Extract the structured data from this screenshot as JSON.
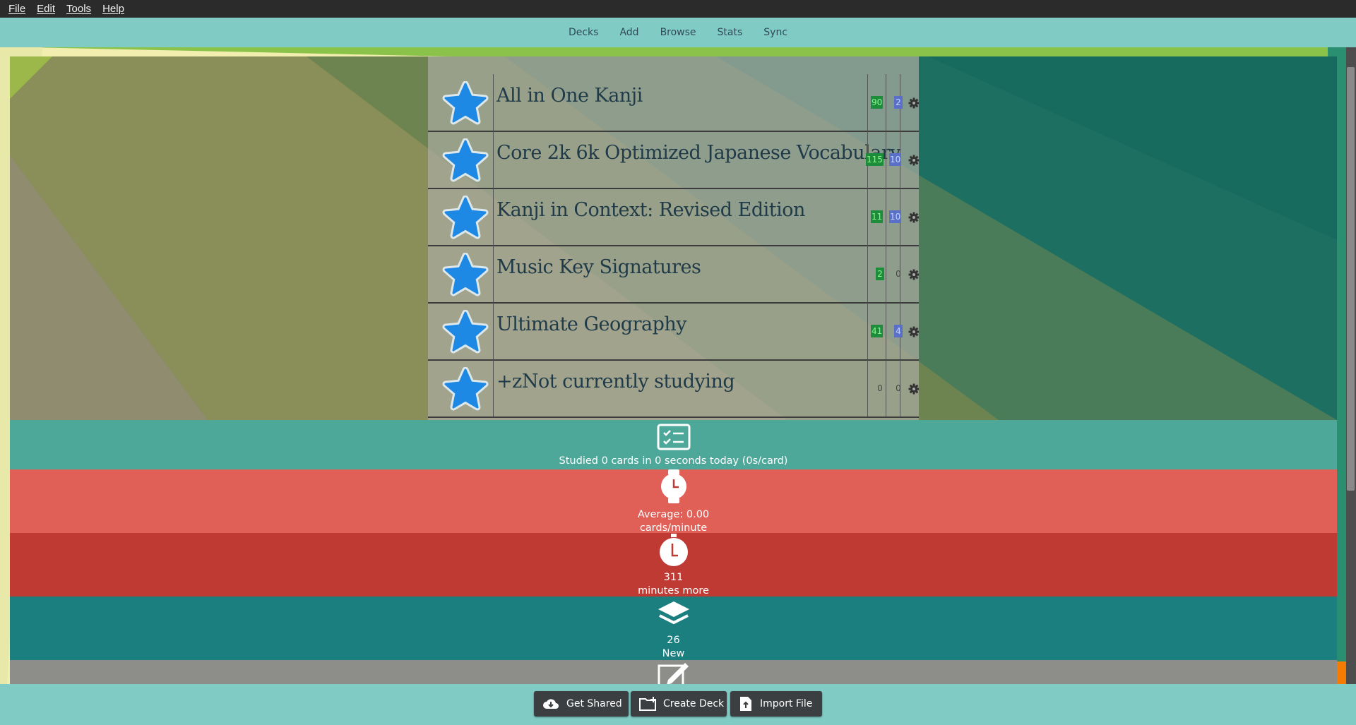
{
  "menu": [
    "File",
    "Edit",
    "Tools",
    "Help"
  ],
  "toolbar": [
    "Decks",
    "Add",
    "Browse",
    "Stats",
    "Sync"
  ],
  "decks": [
    {
      "name": "All in One Kanji",
      "new": "90",
      "review": "2",
      "new_style": "filled",
      "review_style": "filled"
    },
    {
      "name": "Core 2k 6k Optimized Japanese Vocabulary",
      "new": "115",
      "review": "10",
      "new_style": "filled",
      "review_style": "filled"
    },
    {
      "name": "Kanji in Context: Revised Edition",
      "new": "11",
      "review": "10",
      "new_style": "filled",
      "review_style": "filled"
    },
    {
      "name": "Music Key Signatures",
      "new": "2",
      "review": "0",
      "new_style": "filled",
      "review_style": "plain"
    },
    {
      "name": "Ultimate Geography",
      "new": "41",
      "review": "4",
      "new_style": "filled",
      "review_style": "filled"
    },
    {
      "name": "+zNot currently studying",
      "new": "0",
      "review": "0",
      "new_style": "plain",
      "review_style": "plain"
    }
  ],
  "stats": {
    "studied": "Studied 0 cards in 0 seconds today (0s/card)",
    "average_line1": "Average: 0.00",
    "average_line2": "cards/minute",
    "minutes_value": "311",
    "minutes_label": "minutes more",
    "new_value": "26",
    "new_label": "New"
  },
  "bottom_buttons": [
    "Get Shared",
    "Create Deck",
    "Import File"
  ],
  "icons": {
    "deck": "star-icon",
    "options": "gear-icon",
    "studied": "checklist-icon",
    "average": "watch-icon",
    "remaining": "stopwatch-icon",
    "new": "layers-icon",
    "edit": "edit-icon",
    "get_shared": "cloud-download-icon",
    "create_deck": "folder-plus-icon",
    "import_file": "file-upload-icon"
  },
  "colors": {
    "accent": "#80cbc4",
    "new_count": "#1d8d3c",
    "review_count": "#5a6fc8",
    "star": "#1e88e5",
    "band_studied": "#4ea89a",
    "band_average": "#e06058",
    "band_remaining": "#c03a34",
    "band_new": "#1b7f80",
    "band_edit": "#8d8e8a"
  }
}
